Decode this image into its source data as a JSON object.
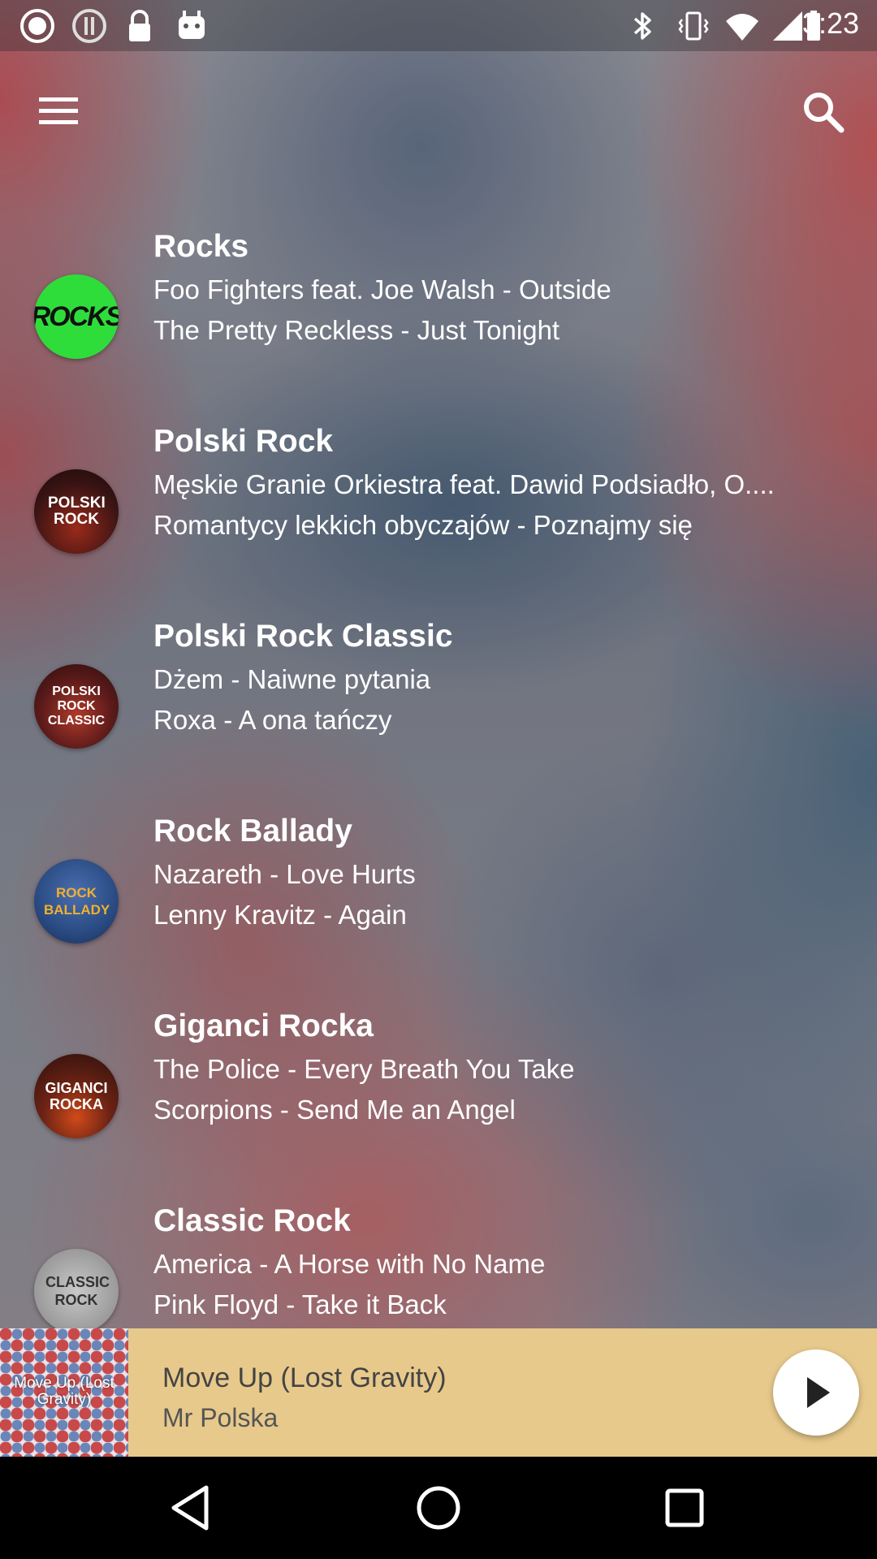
{
  "status_bar": {
    "time": "3:23",
    "icons": [
      "record-icon",
      "alert-icon",
      "lock-icon",
      "android-icon",
      "bluetooth-icon"
    ]
  },
  "toolbar": {
    "menu_icon": "menu-icon",
    "search_icon": "search-icon"
  },
  "stations": [
    {
      "name": "Rocks",
      "logo_text": "ROCKS",
      "track1": "Foo Fighters feat. Joe Walsh - Outside",
      "track2": "The Pretty Reckless - Just Tonight",
      "logo_bg": "#2fdd3a",
      "logo_color": "#111111"
    },
    {
      "name": "Polski Rock",
      "logo_text": "POLSKI ROCK",
      "track1": "Męskie Granie Orkiestra feat. Dawid Podsiadło, O....",
      "track2": "Romantycy lekkich obyczajów - Poznajmy się",
      "logo_bg": "#3a1414",
      "logo_color": "#ffffff"
    },
    {
      "name": "Polski Rock Classic",
      "logo_text": "POLSKI ROCK CLASSIC",
      "track1": "Dżem - Naiwne pytania",
      "track2": "Roxa - A ona tańczy",
      "logo_bg": "#5a1a1a",
      "logo_color": "#ffffff"
    },
    {
      "name": "Rock Ballady",
      "logo_text": "ROCK BALLADY",
      "track1": "Nazareth - Love Hurts",
      "track2": "Lenny Kravitz - Again",
      "logo_bg": "#2a4b82",
      "logo_color": "#ffffff"
    },
    {
      "name": "Giganci Rocka",
      "logo_text": "GIGANCI ROCKA",
      "track1": "The Police - Every Breath You Take",
      "track2": "Scorpions - Send Me an Angel",
      "logo_bg": "#3b1a14",
      "logo_color": "#ffffff"
    },
    {
      "name": "Classic Rock",
      "logo_text": "CLASSIC ROCK",
      "track1": "America - A Horse with No Name",
      "track2": "Pink Floyd - Take it Back",
      "logo_bg": "#9a9a9a",
      "logo_color": "#333333"
    }
  ],
  "now_playing": {
    "album_art_text": "Move Up (Lost Gravity)",
    "title": "Move Up (Lost Gravity)",
    "artist": "Mr Polska",
    "play_icon": "play-icon"
  },
  "nav_bar": {
    "back_icon": "back-icon",
    "home_icon": "home-icon",
    "recents_icon": "recents-icon"
  }
}
